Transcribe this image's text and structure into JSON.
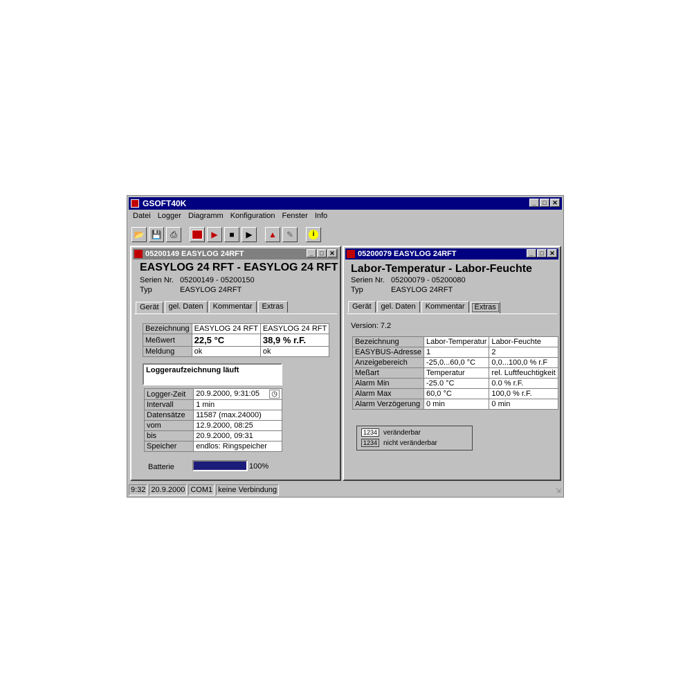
{
  "app": {
    "title": "GSOFT40K",
    "menu": [
      "Datei",
      "Logger",
      "Diagramm",
      "Konfiguration",
      "Fenster",
      "Info"
    ],
    "toolbar_icons": [
      "open-icon",
      "save-icon",
      "print-icon",
      "logger-read-icon",
      "start-icon",
      "stop-icon",
      "play-icon",
      "chart-icon",
      "edit-icon",
      "info-icon"
    ]
  },
  "left_window": {
    "title": "05200149 EASYLOG 24RFT",
    "heading": "EASYLOG 24 RFT - EASYLOG 24 RFT",
    "serial_label": "Serien Nr.",
    "serial_value": "05200149 - 05200150",
    "type_label": "Typ",
    "type_value": "EASYLOG 24RFT",
    "tabs": [
      "Gerät",
      "gel. Daten",
      "Kommentar",
      "Extras"
    ],
    "table1": {
      "rows": [
        [
          "Bezeichnung",
          "EASYLOG 24 RFT",
          "EASYLOG 24 RFT"
        ],
        [
          "Meßwert",
          "22,5 °C",
          "38,9 % r.F."
        ],
        [
          "Meldung",
          "ok",
          "ok"
        ]
      ]
    },
    "status_text": "Loggeraufzeichnung läuft",
    "table2": {
      "rows": [
        [
          "Logger-Zeit",
          "20.9.2000, 9:31:05"
        ],
        [
          "Intervall",
          "1 min"
        ],
        [
          "Datensätze",
          "11587 (max.24000)"
        ],
        [
          "vom",
          "12.9.2000, 08:25"
        ],
        [
          "bis",
          "20.9.2000, 09:31"
        ],
        [
          "Speicher",
          "endlos: Ringspeicher"
        ]
      ]
    },
    "battery_label": "Batterie",
    "battery_value": "100%",
    "battery_level": 1.0
  },
  "right_window": {
    "title": "05200079 EASYLOG 24RFT",
    "heading": "Labor-Temperatur - Labor-Feuchte",
    "serial_label": "Serien Nr.",
    "serial_value": "05200079 - 05200080",
    "type_label": "Typ",
    "type_value": "EASYLOG 24RFT",
    "tabs": [
      "Gerät",
      "gel. Daten",
      "Kommentar",
      "Extras"
    ],
    "version": "Version: 7.2",
    "table": {
      "rows": [
        [
          "Bezeichnung",
          "Labor-Temperatur",
          "Labor-Feuchte"
        ],
        [
          "EASYBUS-Adresse",
          "1",
          "2"
        ],
        [
          "Anzeigebereich",
          "-25,0...60,0 °C",
          "0,0...100,0 % r.F"
        ],
        [
          "Meßart",
          "Temperatur",
          "rel. Luftfeuchtigkeit"
        ],
        [
          "Alarm Min",
          "-25.0 °C",
          "0.0 % r.F."
        ],
        [
          "Alarm Max",
          "60,0 °C",
          "100,0 % r.F."
        ],
        [
          "Alarm Verzögerung",
          "0 min",
          "0 min"
        ]
      ]
    },
    "legend": [
      {
        "badge": "1234",
        "text": "veränderbar"
      },
      {
        "badge": "1234",
        "text": "nicht veränderbar"
      }
    ]
  },
  "statusbar": [
    "9:32",
    "20.9.2000",
    "COM1",
    "keine Verbindung"
  ]
}
